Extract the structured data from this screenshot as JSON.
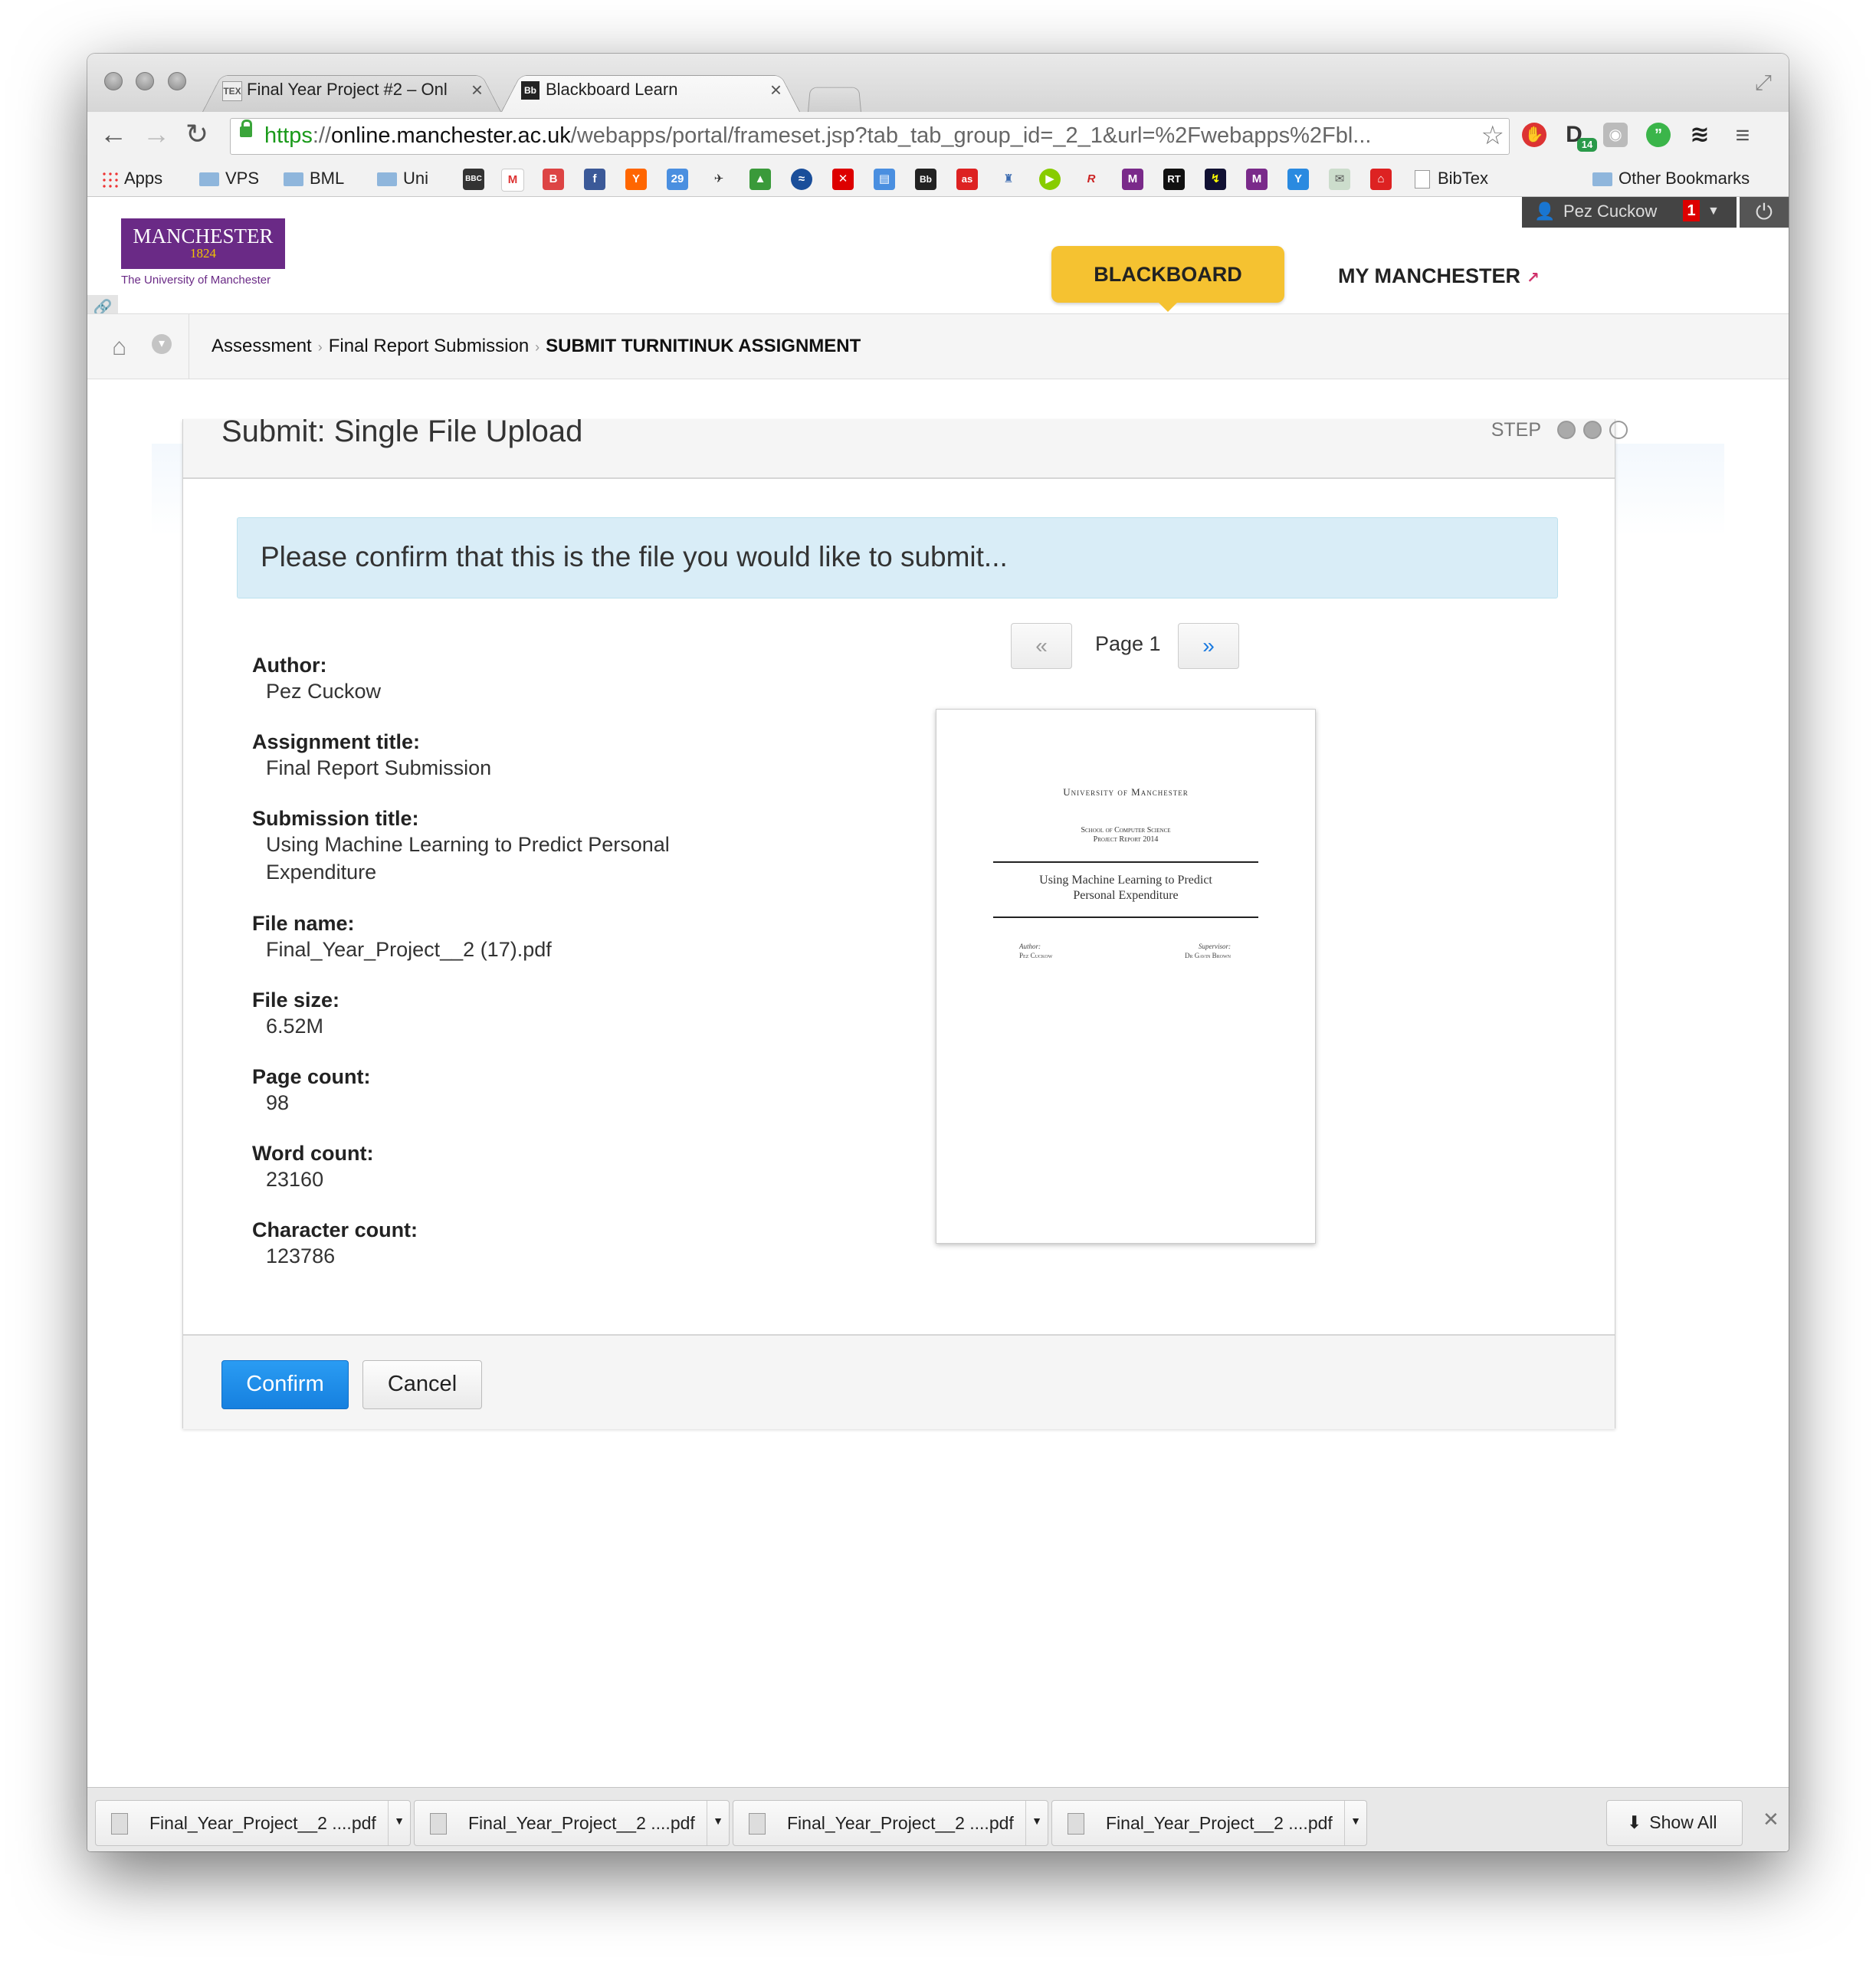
{
  "browser": {
    "tabs": [
      {
        "title": "Final Year Project #2 – Onl",
        "favicon": "TEX"
      },
      {
        "title": "Blackboard Learn",
        "favicon": "Bb"
      }
    ],
    "url_scheme": "https",
    "url_sep": "://",
    "url_host": "online.manchester.ac.uk",
    "url_path": "/webapps/portal/frameset.jsp?tab_tab_group_id=_2_1&url=%2Fwebapps%2Fbl...",
    "extension_badge": "14",
    "bookmarks": {
      "apps": "Apps",
      "vps": "VPS",
      "bml": "BML",
      "uni": "Uni",
      "bibtex": "BibTex",
      "other": "Other Bookmarks"
    }
  },
  "header": {
    "user_name": "Pez Cuckow",
    "notification_count": "1",
    "logo_name": "MANCHESTER",
    "logo_year": "1824",
    "logo_sub": "The University of Manchester",
    "nav_blackboard": "BLACKBOARD",
    "nav_my_manchester": "MY MANCHESTER"
  },
  "breadcrumb": {
    "items": [
      "Assessment",
      "Final Report Submission",
      "SUBMIT TURNITINUK ASSIGNMENT"
    ]
  },
  "submission": {
    "panel_title": "Submit: Single File Upload",
    "step_label": "STEP",
    "info_message": "Please confirm that this is the file you would like to submit...",
    "fields": [
      {
        "label": "Author:",
        "value": "Pez Cuckow"
      },
      {
        "label": "Assignment title:",
        "value": "Final Report Submission"
      },
      {
        "label": "Submission title:",
        "value": "Using Machine Learning to Predict Personal Expenditure"
      },
      {
        "label": "File name:",
        "value": "Final_Year_Project__2 (17).pdf"
      },
      {
        "label": "File size:",
        "value": "6.52M"
      },
      {
        "label": "Page count:",
        "value": "98"
      },
      {
        "label": "Word count:",
        "value": "23160"
      },
      {
        "label": "Character count:",
        "value": "123786"
      }
    ],
    "pager": {
      "prev": "«",
      "label": "Page 1",
      "next": "»"
    },
    "preview": {
      "university": "University of Manchester",
      "school": "School of Computer Science",
      "report": "Project Report 2014",
      "title_line1": "Using Machine Learning to Predict",
      "title_line2": "Personal Expenditure",
      "author_label": "Author:",
      "author": "Pez Cuckow",
      "supervisor_label": "Supervisor:",
      "supervisor": "Dr Gavin Brown"
    },
    "confirm_label": "Confirm",
    "cancel_label": "Cancel"
  },
  "downloads": {
    "items": [
      "Final_Year_Project__2 ....pdf",
      "Final_Year_Project__2 ....pdf",
      "Final_Year_Project__2 ....pdf",
      "Final_Year_Project__2 ....pdf"
    ],
    "show_all": "Show All"
  }
}
